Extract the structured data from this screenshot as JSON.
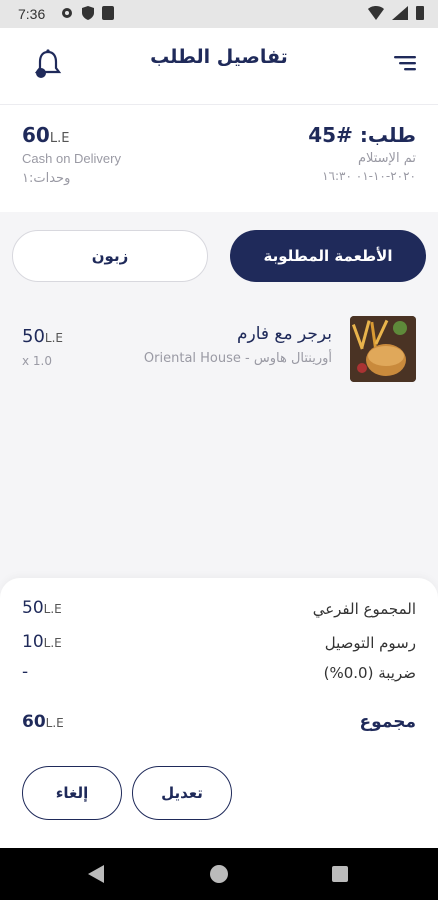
{
  "status_bar": {
    "time": "7:36",
    "icons": [
      "gear-icon",
      "shield-icon",
      "sim-icon",
      "wifi-icon",
      "signal-icon",
      "battery-icon"
    ]
  },
  "header": {
    "title": "تفاصيل الطلب",
    "left_icon": "bell-icon",
    "right_icon": "menu-icon"
  },
  "order": {
    "number": "طلب: #45",
    "status": "تم الإستلام",
    "date": "٢٠٢٠-١٠-٠١ ١٦:٣٠",
    "total_value": "60",
    "currency": "L.E",
    "payment_method": "Cash on Delivery",
    "units": "وحدات:١"
  },
  "tabs": {
    "items": "الأطعمة المطلوبة",
    "customer": "زبون"
  },
  "items": [
    {
      "name": "برجر مع فارم",
      "restaurant": "Oriental House - أورينتال هاوس",
      "price": "50",
      "currency": "L.E",
      "quantity": "x 1.0"
    }
  ],
  "summary": {
    "subtotal_label": "المجموع الفرعي",
    "subtotal_value": "50",
    "delivery_label": "رسوم التوصيل",
    "delivery_value": "10",
    "tax_label": "ضريبة (0.0%)",
    "tax_value": "-",
    "total_label": "مجموع",
    "total_value": "60",
    "currency": "L.E"
  },
  "actions": {
    "edit": "تعديل",
    "cancel": "إلغاء"
  },
  "colors": {
    "primary": "#1f2a5a",
    "background": "#f5f5f7",
    "muted_text": "#9a9aa4"
  }
}
